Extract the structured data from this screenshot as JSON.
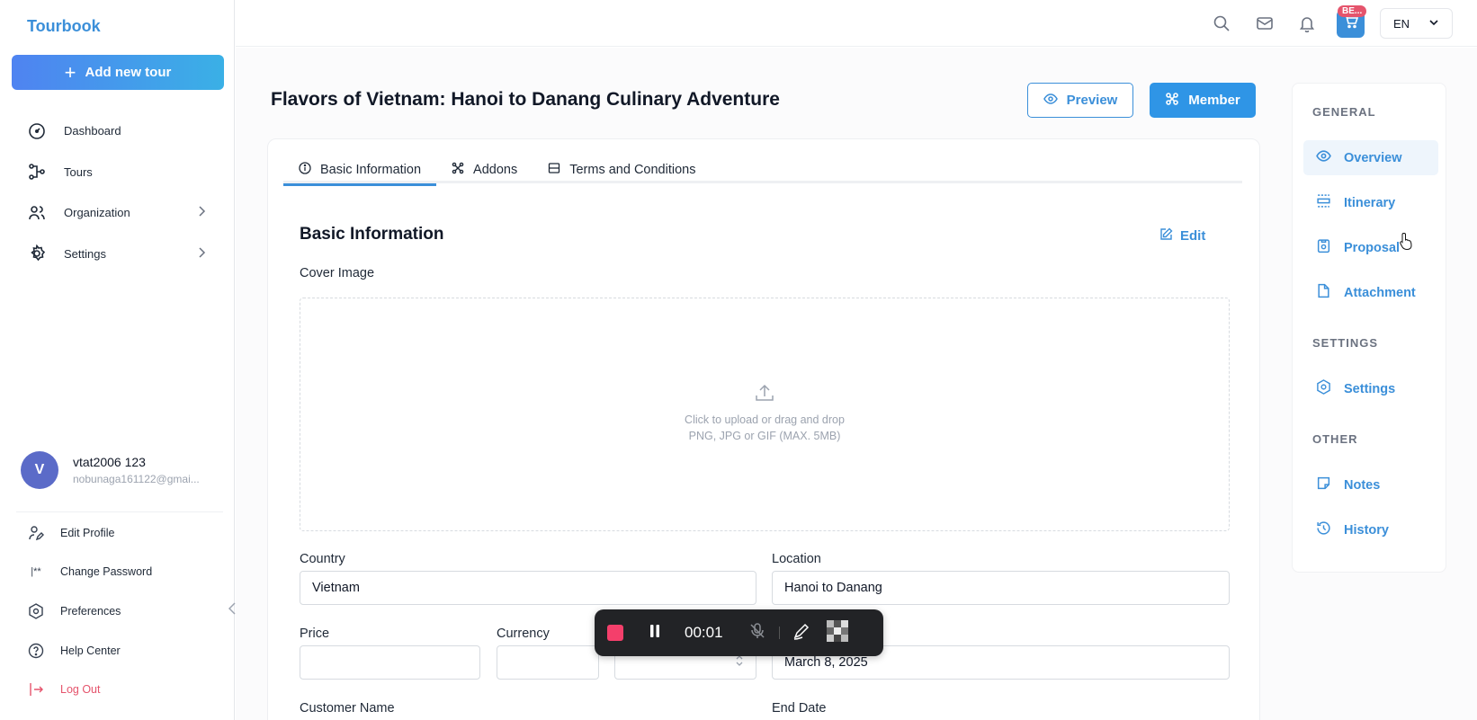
{
  "app": {
    "brand": "Tourbook"
  },
  "sidebar": {
    "add_button": "Add new tour",
    "nav": [
      {
        "label": "Dashboard",
        "icon": "gauge-icon"
      },
      {
        "label": "Tours",
        "icon": "route-icon"
      },
      {
        "label": "Organization",
        "icon": "users-icon"
      },
      {
        "label": "Settings",
        "icon": "gear-icon"
      }
    ],
    "user": {
      "initial": "V",
      "name": "vtat2006 123",
      "email": "nobunaga161122@gmai..."
    },
    "account": [
      {
        "label": "Edit Profile",
        "icon": "user-edit-icon"
      },
      {
        "label": "Change Password",
        "icon": "password-icon"
      },
      {
        "label": "Preferences",
        "icon": "hexagon-gear-icon"
      },
      {
        "label": "Help Center",
        "icon": "help-icon"
      },
      {
        "label": "Log Out",
        "icon": "logout-icon"
      }
    ]
  },
  "topbar": {
    "cart_badge": "BE...",
    "language": "EN"
  },
  "page": {
    "title": "Flavors of Vietnam: Hanoi to Danang Culinary Adventure",
    "preview_button": "Preview",
    "member_button": "Member"
  },
  "tabs": [
    {
      "label": "Basic Information"
    },
    {
      "label": "Addons"
    },
    {
      "label": "Terms and Conditions"
    }
  ],
  "basic_info": {
    "title": "Basic Information",
    "edit": "Edit",
    "cover_label": "Cover Image",
    "upload_line1": "Click to upload or drag and drop",
    "upload_line2": "PNG, JPG or GIF (MAX. 5MB)",
    "country_label": "Country",
    "country_value": "Vietnam",
    "location_label": "Location",
    "location_value": "Hanoi to Danang",
    "price_label": "Price",
    "price_value": "",
    "currency_label": "Currency",
    "currency_value": "",
    "start_date_value": "March 8, 2025",
    "customer_label": "Customer Name",
    "end_date_label": "End Date"
  },
  "recorder": {
    "time": "00:01"
  },
  "right_panel": {
    "general_heading": "GENERAL",
    "general": [
      {
        "label": "Overview",
        "icon": "eye-icon"
      },
      {
        "label": "Itinerary",
        "icon": "itinerary-icon"
      },
      {
        "label": "Proposal",
        "icon": "proposal-icon"
      },
      {
        "label": "Attachment",
        "icon": "file-icon"
      }
    ],
    "settings_heading": "SETTINGS",
    "settings": [
      {
        "label": "Settings",
        "icon": "hexagon-gear-icon"
      }
    ],
    "other_heading": "OTHER",
    "other": [
      {
        "label": "Notes",
        "icon": "note-icon"
      },
      {
        "label": "History",
        "icon": "history-icon"
      }
    ]
  },
  "colors": {
    "accent": "#3b8fd9",
    "danger": "#e5546c",
    "recorder_bg": "#222326"
  }
}
